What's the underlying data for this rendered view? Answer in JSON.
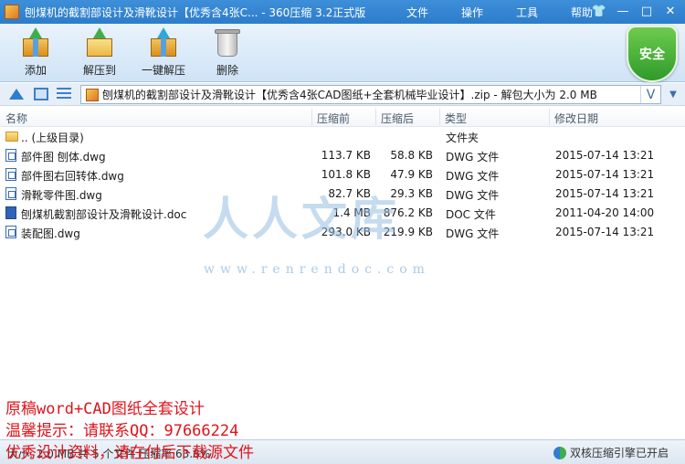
{
  "window": {
    "title": "刨煤机的截割部设计及滑靴设计【优秀含4张C... - 360压缩 3.2正式版",
    "menu": [
      "文件",
      "操作",
      "工具",
      "帮助"
    ],
    "controls": {
      "skin": "👕",
      "minimize": "—",
      "maximize": "□",
      "close": "✕"
    }
  },
  "toolbar": {
    "buttons": [
      {
        "label": "添加",
        "icon": "add-archive-icon"
      },
      {
        "label": "解压到",
        "icon": "extract-to-icon"
      },
      {
        "label": "一键解压",
        "icon": "one-click-extract-icon"
      },
      {
        "label": "删除",
        "icon": "trash-icon"
      }
    ],
    "security_badge": "安全"
  },
  "address": {
    "path": "刨煤机的截割部设计及滑靴设计【优秀含4张CAD图纸+全套机械毕业设计】.zip - 解包大小为 2.0 MB",
    "dropdown": "V"
  },
  "list": {
    "columns": [
      "名称",
      "压缩前",
      "压缩后",
      "类型",
      "修改日期"
    ],
    "rows": [
      {
        "name": ".. (上级目录)",
        "packed": "",
        "unpacked": "",
        "type": "文件夹",
        "date": "",
        "kind": "folder"
      },
      {
        "name": "部件图 刨体.dwg",
        "packed": "113.7 KB",
        "unpacked": "58.8 KB",
        "type": "DWG 文件",
        "date": "2015-07-14 13:21",
        "kind": "dwg"
      },
      {
        "name": "部件图右回转体.dwg",
        "packed": "101.8 KB",
        "unpacked": "47.9 KB",
        "type": "DWG 文件",
        "date": "2015-07-14 13:21",
        "kind": "dwg"
      },
      {
        "name": "滑靴零件图.dwg",
        "packed": "82.7 KB",
        "unpacked": "29.3 KB",
        "type": "DWG 文件",
        "date": "2015-07-14 13:21",
        "kind": "dwg"
      },
      {
        "name": "刨煤机截割部设计及滑靴设计.doc",
        "packed": "1.4 MB",
        "unpacked": "876.2 KB",
        "type": "DOC 文件",
        "date": "2011-04-20 14:00",
        "kind": "doc"
      },
      {
        "name": "装配图.dwg",
        "packed": "293.0 KB",
        "unpacked": "219.9 KB",
        "type": "DWG 文件",
        "date": "2015-07-14 13:21",
        "kind": "dwg"
      }
    ]
  },
  "watermark": {
    "big": "人人文库",
    "url": "www.renrendoc.com"
  },
  "promo": [
    "原稿word+CAD图纸全套设计",
    "温馨提示：请联系QQ：97666224",
    "优秀设计资料，请在付后下载源文件"
  ],
  "status": {
    "left": "大小: 2.0 MB 共 5 个文件 压缩率 63.8%",
    "right": "双核压缩引擎已开启"
  }
}
